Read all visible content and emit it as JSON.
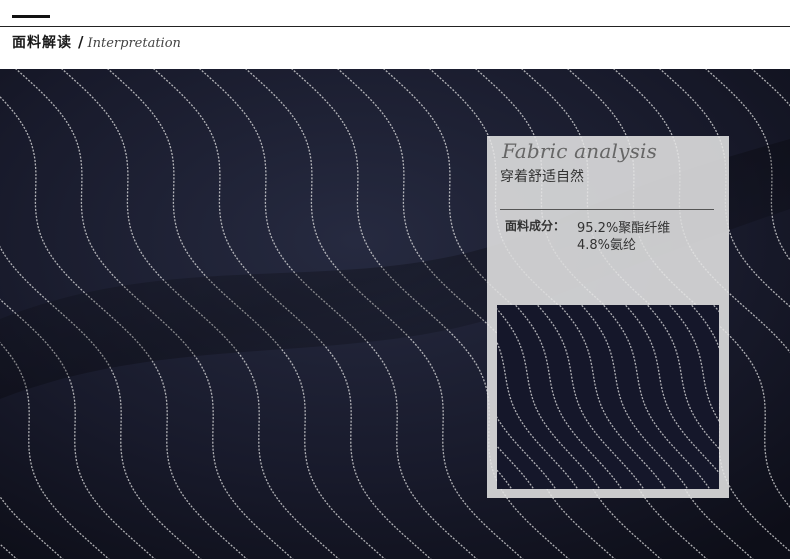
{
  "header": {
    "title_cn": "面料解读",
    "separator": "/",
    "title_en": "Interpretation"
  },
  "panel": {
    "heading": "Fabric analysis",
    "subtitle": "穿着舒适自然",
    "composition_label": "面料成分：",
    "composition": [
      "95.2%聚酯纤维",
      "4.8%氨纶"
    ]
  },
  "colors": {
    "fabric": "#181a2a",
    "stripe": "#e6e6e6",
    "panel": "#e4e4e4"
  }
}
